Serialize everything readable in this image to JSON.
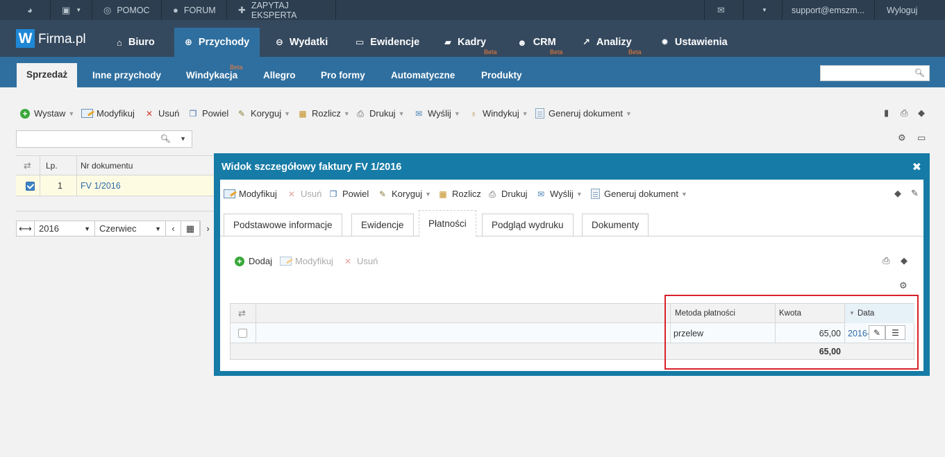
{
  "topbar": {
    "help": "POMOC",
    "forum": "FORUM",
    "expert": "ZAPYTAJ EKSPERTA",
    "email": "support@emszm...",
    "logout": "Wyloguj"
  },
  "header": {
    "logo_letter": "W",
    "logo_text": "Firma.pl",
    "nav": [
      {
        "label": "Biuro",
        "icon": "home-icon"
      },
      {
        "label": "Przychody",
        "icon": "plus-circle-icon"
      },
      {
        "label": "Wydatki",
        "icon": "minus-circle-icon"
      },
      {
        "label": "Ewidencje",
        "icon": "inbox-icon"
      },
      {
        "label": "Kadry",
        "icon": "folder-icon",
        "badge": "Beta"
      },
      {
        "label": "CRM",
        "icon": "users-icon",
        "badge": "Beta"
      },
      {
        "label": "Analizy",
        "icon": "chart-icon",
        "badge": "Beta"
      },
      {
        "label": "Ustawienia",
        "icon": "gear-icon"
      }
    ]
  },
  "subnav": {
    "items": [
      {
        "label": "Sprzedaż"
      },
      {
        "label": "Inne przychody"
      },
      {
        "label": "Windykacja",
        "badge": "Beta"
      },
      {
        "label": "Allegro"
      },
      {
        "label": "Pro formy"
      },
      {
        "label": "Automatyczne"
      },
      {
        "label": "Produkty"
      }
    ],
    "search_placeholder": ""
  },
  "toolbar": {
    "issue": "Wystaw",
    "modify": "Modyfikuj",
    "delete": "Usuń",
    "duplicate": "Powiel",
    "correct": "Koryguj",
    "settle": "Rozlicz",
    "print": "Drukuj",
    "send": "Wyślij",
    "collect": "Windykuj",
    "generate": "Generuj dokument"
  },
  "search": {
    "placeholder": ""
  },
  "left_grid": {
    "col_lp": "Lp.",
    "col_doc": "Nr dokumentu",
    "rows": [
      {
        "lp": "1",
        "doc": "FV 1/2016"
      }
    ]
  },
  "period": {
    "year": "2016",
    "month": "Czerwiec"
  },
  "modal": {
    "title": "Widok szczegółowy faktury FV 1/2016",
    "toolbar": {
      "modify": "Modyfikuj",
      "delete": "Usuń",
      "duplicate": "Powiel",
      "correct": "Koryguj",
      "settle": "Rozlicz",
      "print": "Drukuj",
      "send": "Wyślij",
      "generate": "Generuj dokument"
    },
    "tabs": [
      {
        "label": "Podstawowe informacje"
      },
      {
        "label": "Ewidencje"
      },
      {
        "label": "Płatności"
      },
      {
        "label": "Podgląd wydruku"
      },
      {
        "label": "Dokumenty"
      }
    ],
    "payments": {
      "add": "Dodaj",
      "modify": "Modyfikuj",
      "delete": "Usuń",
      "col_method": "Metoda płatności",
      "col_amount": "Kwota",
      "col_date": "Data",
      "rows": [
        {
          "method": "przelew",
          "amount": "65,00",
          "date": "2016-"
        }
      ],
      "total": "65,00"
    }
  }
}
